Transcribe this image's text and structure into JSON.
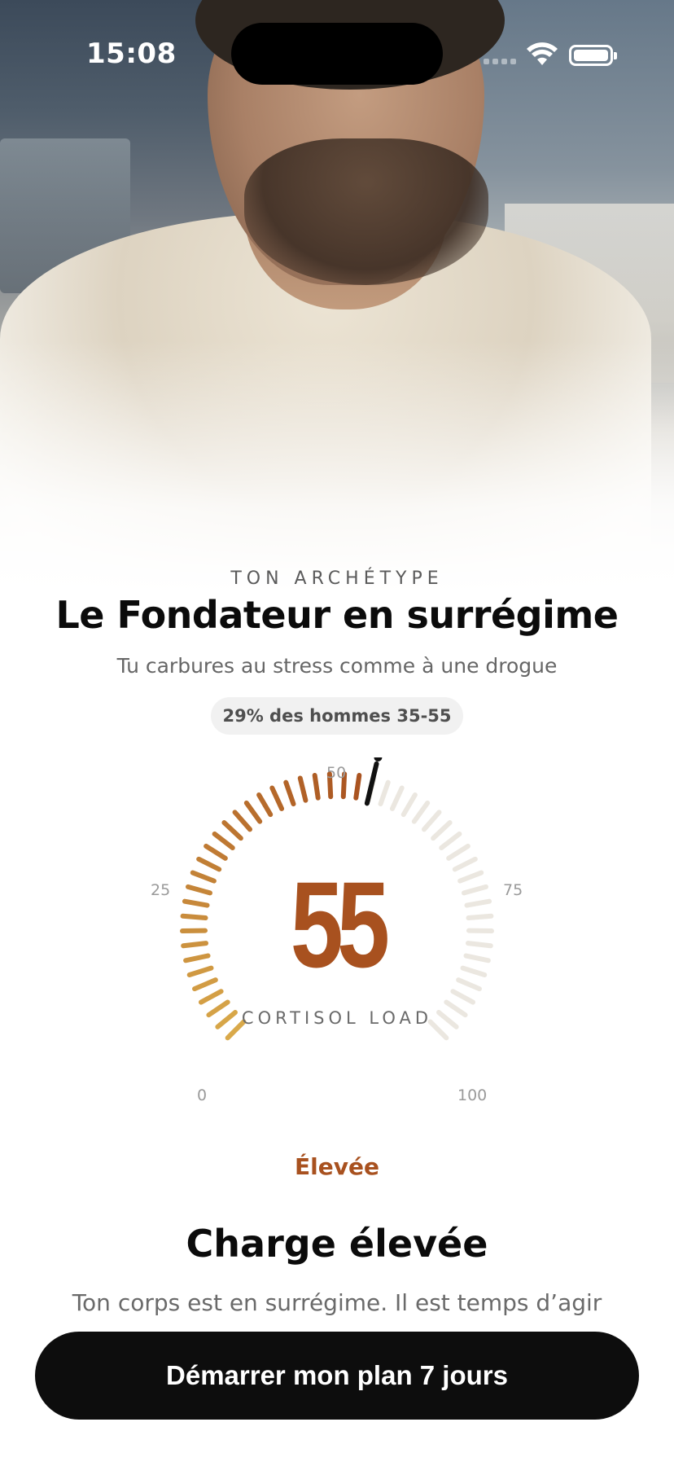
{
  "status_bar": {
    "time": "15:08",
    "icons": [
      "signal-icon",
      "wifi-icon",
      "battery-icon"
    ]
  },
  "hero": {
    "image_description": "man-at-desk-photo"
  },
  "archetype": {
    "eyebrow": "TON ARCHÉTYPE",
    "title": "Le Fondateur en surrégime",
    "subtitle": "Tu carbures au stress comme à une drogue",
    "stat_pill": "29% des hommes 35-55"
  },
  "gauge": {
    "min_label": "0",
    "q1_label": "25",
    "mid_label": "50",
    "q3_label": "75",
    "max_label": "100",
    "min": 0,
    "max": 100,
    "value": 55,
    "value_text": "55",
    "caption": "CORTISOL LOAD",
    "tick_count": 50,
    "colors": {
      "low": "#d9a94a",
      "high": "#a8511f",
      "inactive": "#ebe7e0",
      "needle": "#111111",
      "value_text": "#a8511f"
    }
  },
  "level": {
    "label": "Élevée",
    "title": "Charge élevée",
    "description": "Ton corps est en surrégime. Il est temps d’agir"
  },
  "cta": {
    "label": "Démarrer mon plan 7 jours"
  }
}
